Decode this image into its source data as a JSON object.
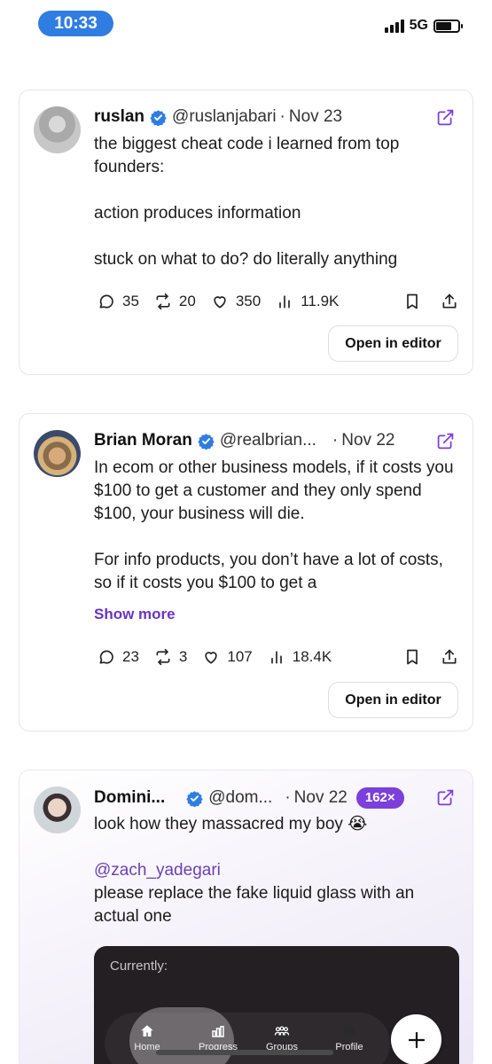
{
  "status_bar": {
    "time": "10:33",
    "network": "5G"
  },
  "posts": [
    {
      "name": "ruslan",
      "handle": "@ruslanjabari",
      "separator": "·",
      "date": "Nov 23",
      "lines": [
        "the biggest cheat code i learned from top founders:",
        "",
        "action produces information",
        "",
        "stuck on what to do? do literally anything"
      ],
      "replies": "35",
      "reposts": "20",
      "likes": "350",
      "views": "11.9K",
      "open_label": "Open in editor"
    },
    {
      "name": "Brian Moran",
      "handle": "@realbrian...",
      "separator": "·",
      "date": "Nov 22",
      "lines": [
        "In ecom or other business models, if it costs you $100 to get a customer and they only spend $100, your business will die.",
        "",
        "For info products, you don’t have a lot of costs, so if it costs you $100 to get a"
      ],
      "show_more": "Show more",
      "replies": "23",
      "reposts": "3",
      "likes": "107",
      "views": "18.4K",
      "open_label": "Open in editor"
    },
    {
      "name": "Domini...",
      "handle": "@dom...",
      "separator": "·",
      "date": "Nov 22",
      "badge": "162×",
      "line1": "look how they massacred my boy 😭",
      "mention": "@zach_yadegari",
      "line2": "please replace the fake liquid glass with an actual one",
      "embed_label": "Currently:"
    }
  ],
  "nav": {
    "tabs": [
      "Home",
      "Progress",
      "Groups",
      "Profile"
    ]
  },
  "colors": {
    "accent": "#6a33c2",
    "verified": "#2f7de1",
    "time_pill": "#2f7de1"
  }
}
